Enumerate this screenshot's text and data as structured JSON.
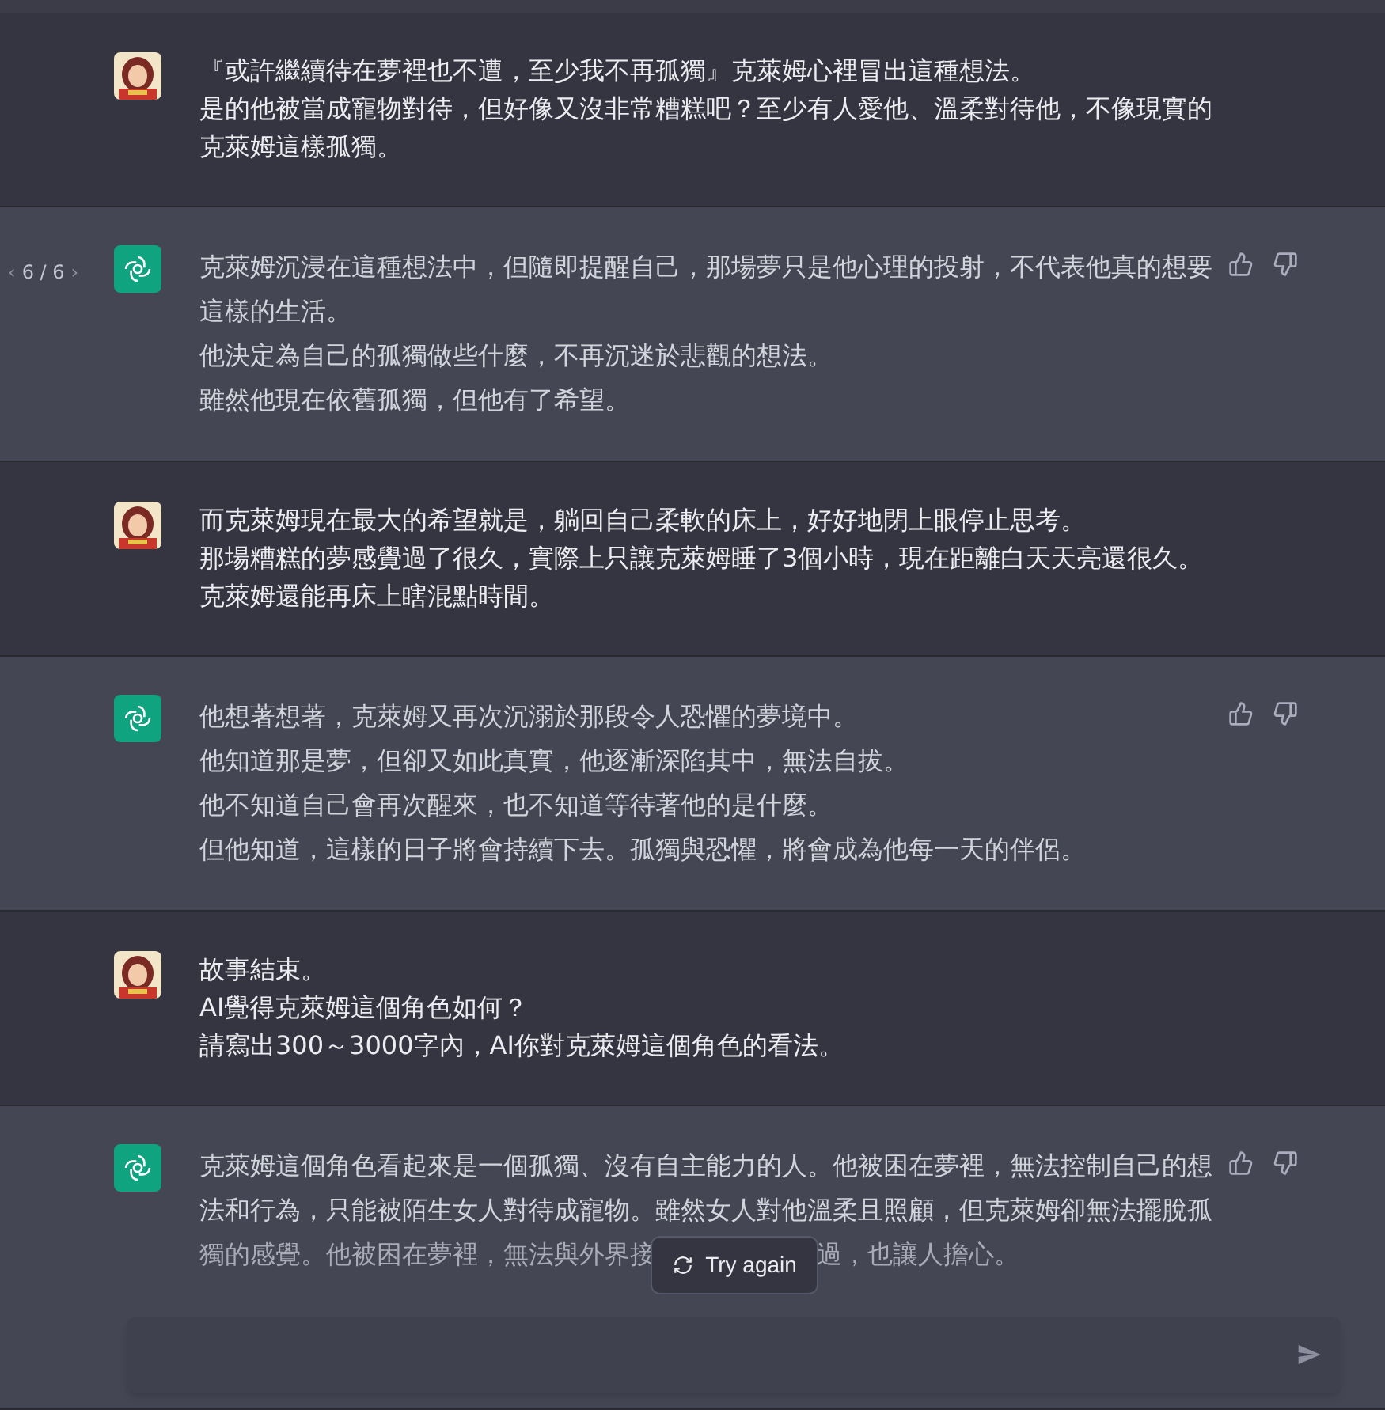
{
  "messages": [
    {
      "kind": "user",
      "lines": [
        "『或許繼續待在夢裡也不遭，至少我不再孤獨』克萊姆心裡冒出這種想法。",
        "是的他被當成寵物對待，但好像又沒非常糟糕吧？至少有人愛他、溫柔對待他，不像現實的",
        "克萊姆這樣孤獨。"
      ]
    },
    {
      "kind": "assistant",
      "pager": {
        "prev": "‹",
        "count": "6 / 6",
        "next": "›"
      },
      "lines": [
        "克萊姆沉浸在這種想法中，但隨即提醒自己，那場夢只是他心理的投射，不代表他真的想要",
        "這樣的生活。",
        "他決定為自己的孤獨做些什麼，不再沉迷於悲觀的想法。",
        "雖然他現在依舊孤獨，但他有了希望。"
      ]
    },
    {
      "kind": "user",
      "lines": [
        "而克萊姆現在最大的希望就是，躺回自己柔軟的床上，好好地閉上眼停止思考。",
        "那場糟糕的夢感覺過了很久，實際上只讓克萊姆睡了3個小時，現在距離白天天亮還很久。",
        "克萊姆還能再床上瞎混點時間。"
      ]
    },
    {
      "kind": "assistant",
      "lines": [
        "他想著想著，克萊姆又再次沉溺於那段令人恐懼的夢境中。",
        "他知道那是夢，但卻又如此真實，他逐漸深陷其中，無法自拔。",
        "他不知道自己會再次醒來，也不知道等待著他的是什麼。",
        "但他知道，這樣的日子將會持續下去。孤獨與恐懼，將會成為他每一天的伴侶。"
      ]
    },
    {
      "kind": "user",
      "lines": [
        "故事結束。",
        "AI覺得克萊姆這個角色如何？",
        "請寫出300～3000字內，AI你對克萊姆這個角色的看法。"
      ]
    },
    {
      "kind": "assistant",
      "lines": [
        "克萊姆這個角色看起來是一個孤獨、沒有自主能力的人。他被困在夢裡，無法控制自己的想",
        "法和行為，只能被陌生女人對待成寵物。雖然女人對他溫柔且照顧，但克萊姆卻無法擺脫孤"
      ],
      "split_line": [
        "獨的感覺。他被困在夢裡，無法與外界接",
        "過，也讓人擔心。"
      ]
    }
  ],
  "try_again": "Try again"
}
